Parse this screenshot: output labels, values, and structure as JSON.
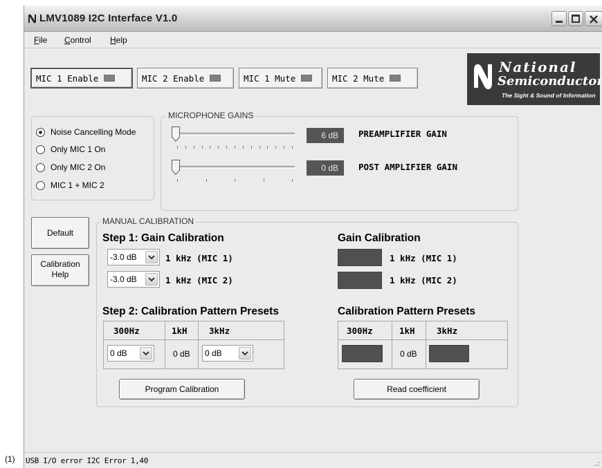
{
  "figure_label": "(1)",
  "window": {
    "title": "LMV1089 I2C Interface V1.0"
  },
  "menu": {
    "file_first": "F",
    "file_rest": "ile",
    "control_first": "C",
    "control_rest": "ontrol",
    "help_first": "H",
    "help_rest": "elp"
  },
  "toggles": {
    "mic1_enable": "MIC 1 Enable",
    "mic2_enable": "MIC 2 Enable",
    "mic1_mute": "MIC 1 Mute",
    "mic2_mute": "MIC 2 Mute"
  },
  "logo": {
    "line1": "National",
    "line2": "Semiconductor",
    "tagline": "The Sight & Sound of Information"
  },
  "modes": {
    "selected_index": 0,
    "items": [
      "Noise Cancelling Mode",
      "Only MIC 1 On",
      "Only MIC 2 On",
      "MIC 1 + MIC 2"
    ]
  },
  "gains": {
    "legend": "MICROPHONE GAINS",
    "preamp": {
      "value": "6 dB",
      "label": "PREAMPLIFIER GAIN",
      "ticks": 15
    },
    "postamp": {
      "value": "0 dB",
      "label": "POST AMPLIFIER GAIN",
      "ticks": 5
    }
  },
  "buttons": {
    "default": "Default",
    "cal_help_1": "Calibration",
    "cal_help_2": "Help",
    "program": "Program Calibration",
    "read": "Read coefficient"
  },
  "calibration": {
    "legend": "MANUAL CALIBRATION",
    "step1_title": "Step 1: Gain Calibration",
    "step1_rows": [
      {
        "value": "-3.0 dB",
        "label": "1 kHz (MIC 1)"
      },
      {
        "value": "-3.0 dB",
        "label": "1 kHz (MIC 2)"
      }
    ],
    "readback_title": "Gain Calibration",
    "readback_rows": [
      "1 kHz (MIC 1)",
      "1 kHz (MIC 2)"
    ],
    "step2_title": "Step 2: Calibration Pattern Presets",
    "presets_title": "Calibration Pattern Presets",
    "preset_headers": [
      "300Hz",
      "1kH",
      "3kHz"
    ],
    "preset_values": {
      "hz300": "0 dB",
      "khz1": "0 dB",
      "khz3": "0 dB"
    },
    "readback_khz1": "0 dB"
  },
  "status": {
    "text": "USB I/O error  I2C Error  1,40"
  }
}
